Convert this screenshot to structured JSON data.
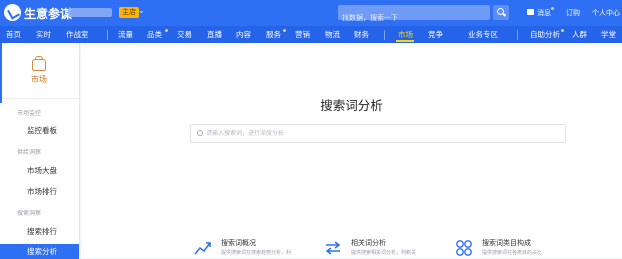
{
  "header": {
    "brand": "生意参谋",
    "shop_badge": "主店",
    "search_placeholder": "找数据，搜索一下",
    "message_label": "消息",
    "order_label": "订购",
    "user_center_label": "个人中心"
  },
  "nav": {
    "items": [
      {
        "label": "首页"
      },
      {
        "label": "实时"
      },
      {
        "label": "作战室"
      },
      {
        "label": "流量"
      },
      {
        "label": "品类"
      },
      {
        "label": "交易"
      },
      {
        "label": "直播"
      },
      {
        "label": "内容"
      },
      {
        "label": "服务"
      },
      {
        "label": "营销"
      },
      {
        "label": "物流"
      },
      {
        "label": "财务"
      },
      {
        "label": "市场"
      },
      {
        "label": "竞争"
      },
      {
        "label": "业务专区"
      },
      {
        "label": "自助分析"
      },
      {
        "label": "人群"
      },
      {
        "label": "学堂"
      }
    ],
    "active": "市场"
  },
  "sidebar": {
    "header_label": "市场",
    "groups": [
      {
        "label": "市场监控",
        "items": [
          {
            "label": "监控看板"
          }
        ]
      },
      {
        "label": "供给洞察",
        "items": [
          {
            "label": "市场大盘"
          },
          {
            "label": "市场排行"
          }
        ]
      },
      {
        "label": "搜索洞察",
        "items": [
          {
            "label": "搜索排行"
          },
          {
            "label": "搜索分析"
          }
        ]
      }
    ],
    "active": "搜索分析"
  },
  "main": {
    "title": "搜索词分析",
    "search_placeholder": "请输入搜索词，进行深度分析",
    "cards": [
      {
        "title": "搜索词概况",
        "desc": "提供搜索词在搜索趋势分析，利"
      },
      {
        "title": "相关词分析",
        "desc": "提供搜索相关词分析，判断关"
      },
      {
        "title": "搜索词类目构成",
        "desc": "提供搜索词在各类目的占比"
      }
    ]
  },
  "colors": {
    "primary": "#2e6ff4",
    "nav_active": "#ffd400",
    "sidebar_accent": "#c9782c"
  }
}
